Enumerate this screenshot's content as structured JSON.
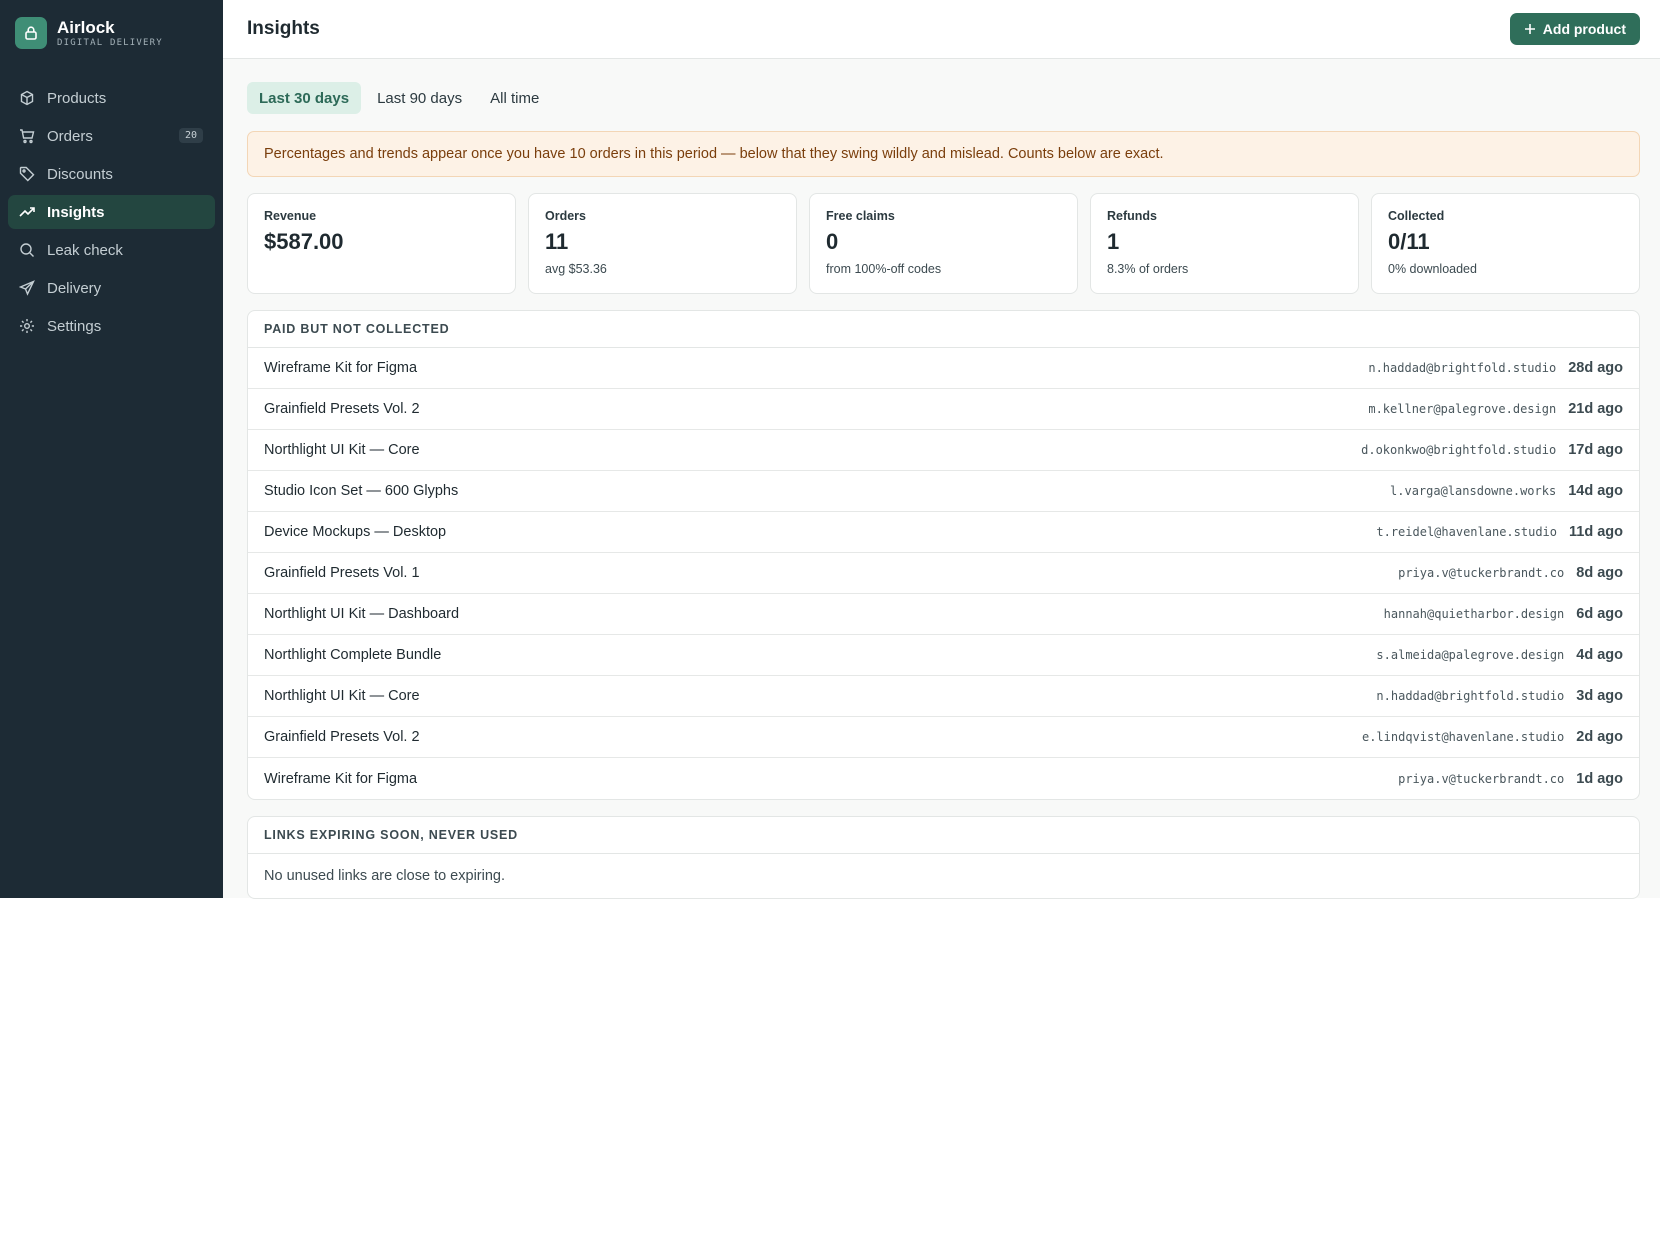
{
  "brand": {
    "name": "Airlock",
    "subtitle": "DIGITAL DELIVERY"
  },
  "nav": [
    {
      "label": "Products",
      "icon": "box-icon",
      "active": false
    },
    {
      "label": "Orders",
      "icon": "cart-icon",
      "badge": "20",
      "active": false
    },
    {
      "label": "Discounts",
      "icon": "tag-icon",
      "active": false
    },
    {
      "label": "Insights",
      "icon": "trend-icon",
      "active": true
    },
    {
      "label": "Leak check",
      "icon": "search-icon",
      "active": false
    },
    {
      "label": "Delivery",
      "icon": "send-icon",
      "active": false
    },
    {
      "label": "Settings",
      "icon": "gear-icon",
      "active": false
    }
  ],
  "header": {
    "title": "Insights",
    "add_label": "Add product"
  },
  "tabs": [
    {
      "label": "Last 30 days",
      "active": true
    },
    {
      "label": "Last 90 days",
      "active": false
    },
    {
      "label": "All time",
      "active": false
    }
  ],
  "notice": "Percentages and trends appear once you have 10 orders in this period — below that they swing wildly and mislead. Counts below are exact.",
  "stats": [
    {
      "label": "Revenue",
      "value": "$587.00",
      "sub": ""
    },
    {
      "label": "Orders",
      "value": "11",
      "sub": "avg $53.36"
    },
    {
      "label": "Free claims",
      "value": "0",
      "sub": "from 100%-off codes"
    },
    {
      "label": "Refunds",
      "value": "1",
      "sub": "8.3% of orders"
    },
    {
      "label": "Collected",
      "value": "0/11",
      "sub": "0% downloaded"
    }
  ],
  "uncollected": {
    "title": "PAID BUT NOT COLLECTED",
    "rows": [
      {
        "product": "Wireframe Kit for Figma",
        "email": "n.haddad@brightfold.studio",
        "age": "28d ago"
      },
      {
        "product": "Grainfield Presets Vol. 2",
        "email": "m.kellner@palegrove.design",
        "age": "21d ago"
      },
      {
        "product": "Northlight UI Kit — Core",
        "email": "d.okonkwo@brightfold.studio",
        "age": "17d ago"
      },
      {
        "product": "Studio Icon Set — 600 Glyphs",
        "email": "l.varga@lansdowne.works",
        "age": "14d ago"
      },
      {
        "product": "Device Mockups — Desktop",
        "email": "t.reidel@havenlane.studio",
        "age": "11d ago"
      },
      {
        "product": "Grainfield Presets Vol. 1",
        "email": "priya.v@tuckerbrandt.co",
        "age": "8d ago"
      },
      {
        "product": "Northlight UI Kit — Dashboard",
        "email": "hannah@quietharbor.design",
        "age": "6d ago"
      },
      {
        "product": "Northlight Complete Bundle",
        "email": "s.almeida@palegrove.design",
        "age": "4d ago"
      },
      {
        "product": "Northlight UI Kit — Core",
        "email": "n.haddad@brightfold.studio",
        "age": "3d ago"
      },
      {
        "product": "Grainfield Presets Vol. 2",
        "email": "e.lindqvist@havenlane.studio",
        "age": "2d ago"
      },
      {
        "product": "Wireframe Kit for Figma",
        "email": "priya.v@tuckerbrandt.co",
        "age": "1d ago"
      }
    ]
  },
  "expiring": {
    "title": "LINKS EXPIRING SOON, NEVER USED",
    "empty": "No unused links are close to expiring."
  },
  "colors": {
    "sidebar": "#1d2b35",
    "accent": "#2f6e5a",
    "notice_bg": "#fdf2e6"
  }
}
